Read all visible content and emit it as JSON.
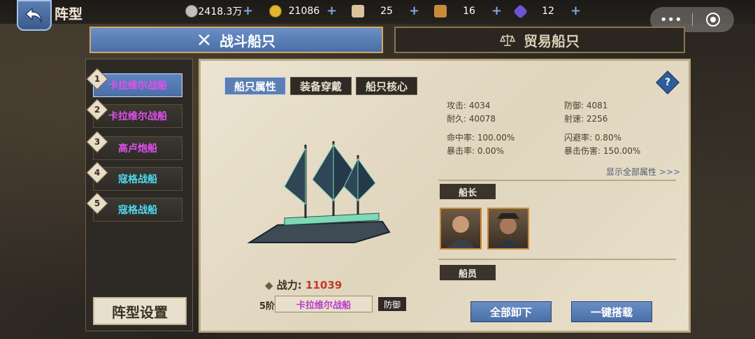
{
  "header": {
    "title": "阵型",
    "resources": [
      {
        "name": "silver",
        "value": "2418.3万",
        "color": "#bfbfbf"
      },
      {
        "name": "gold",
        "value": "21086",
        "color": "#e2b52f"
      },
      {
        "name": "scroll",
        "value": "25",
        "color": "#d8c39a"
      },
      {
        "name": "map",
        "value": "16",
        "color": "#c98b3a"
      },
      {
        "name": "gem",
        "value": "12",
        "color": "#6b55d1"
      }
    ],
    "capsule_more": "•••"
  },
  "main_tabs": {
    "battle": "战斗船只",
    "trade": "贸易船只"
  },
  "ship_list": [
    {
      "num": "1",
      "name": "卡拉维尔战船",
      "color": "#e050f0"
    },
    {
      "num": "2",
      "name": "卡拉维尔战船",
      "color": "#e050f0"
    },
    {
      "num": "3",
      "name": "高卢炮船",
      "color": "#e050f0"
    },
    {
      "num": "4",
      "name": "寇格战船",
      "color": "#4fd8ef"
    },
    {
      "num": "5",
      "name": "寇格战船",
      "color": "#4fd8ef"
    }
  ],
  "formation_button": "阵型设置",
  "sub_tabs": [
    "船只属性",
    "装备穿戴",
    "船只核心"
  ],
  "help": "?",
  "stats": {
    "attack": "攻击: 4034",
    "defense": "防御: 4081",
    "durability": "耐久: 40078",
    "range": "射速: 2256",
    "hit": "命中率: 100.00%",
    "dodge": "闪避率: 0.80%",
    "crit": "暴击率: 0.00%",
    "crit_dmg": "暴击伤害: 150.00%"
  },
  "show_all": "显示全部属性",
  "captain_label": "船长",
  "crew_label": "船员",
  "power_label": "战力:",
  "power_value": "11039",
  "tier": "5阶",
  "ship_name": "卡拉维尔战船",
  "role": "防御",
  "buttons": {
    "unload_all": "全部卸下",
    "one_click": "一键搭载"
  }
}
